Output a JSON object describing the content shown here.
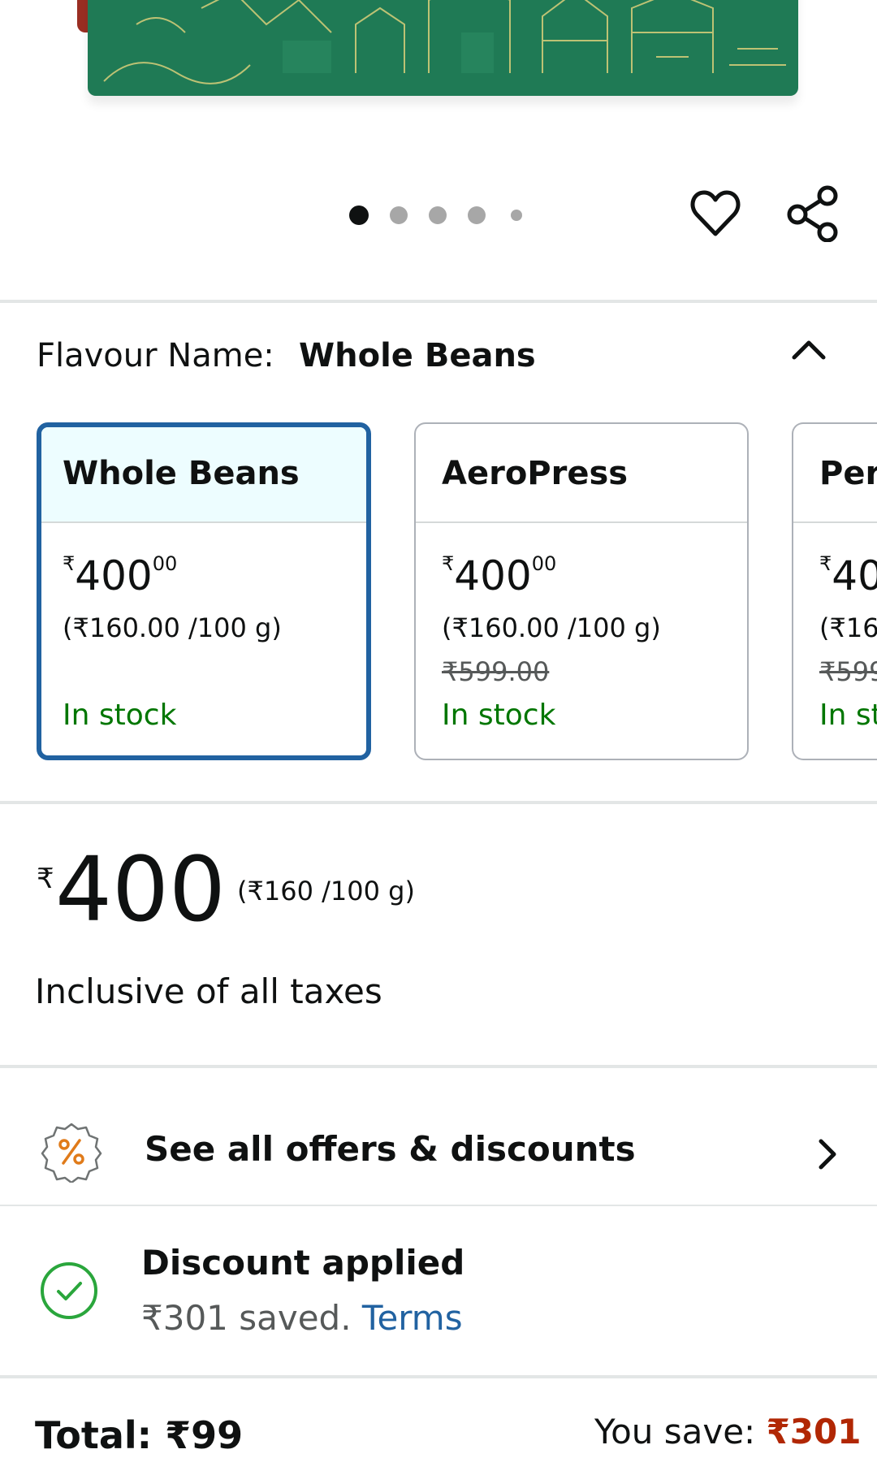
{
  "carousel": {
    "total_images": 5,
    "active_index": 0
  },
  "actions": {
    "wishlist_icon": "heart-icon",
    "share_icon": "share-icon"
  },
  "flavour": {
    "label": "Flavour Name:",
    "selected": "Whole Beans",
    "collapse_icon": "chevron-up-icon"
  },
  "variants": [
    {
      "name": "Whole Beans",
      "currency": "₹",
      "price_whole": "400",
      "price_fraction": "00",
      "unit_price": "(₹160.00 /100 g)",
      "mrp": "",
      "stock": "In stock"
    },
    {
      "name": "AeroPress",
      "currency": "₹",
      "price_whole": "400",
      "price_fraction": "00",
      "unit_price": "(₹160.00 /100 g)",
      "mrp": "₹599.00",
      "stock": "In stock"
    },
    {
      "name": "Per",
      "currency": "₹",
      "price_whole": "40",
      "price_fraction": "",
      "unit_price": "(₹16",
      "mrp": "₹599",
      "stock": "In st"
    }
  ],
  "price": {
    "currency": "₹",
    "amount": "400",
    "unit_price": "(₹160 /100 g)",
    "tax_note": "Inclusive of all taxes"
  },
  "offers": {
    "label": "See all offers & discounts",
    "icon": "percent-badge-icon"
  },
  "discount": {
    "title": "Discount applied",
    "saved_text": "₹301 saved.",
    "terms_link": "Terms",
    "icon": "check-circle-icon"
  },
  "summary": {
    "total_label": "Total:",
    "total_value": "₹99",
    "save_label": "You save:",
    "save_value": "₹301"
  },
  "colors": {
    "accent_blue": "#2162a1",
    "in_stock_green": "#007600",
    "savings_red": "#b12704",
    "offer_orange": "#e07b1a",
    "success_green": "#2aa63c"
  }
}
